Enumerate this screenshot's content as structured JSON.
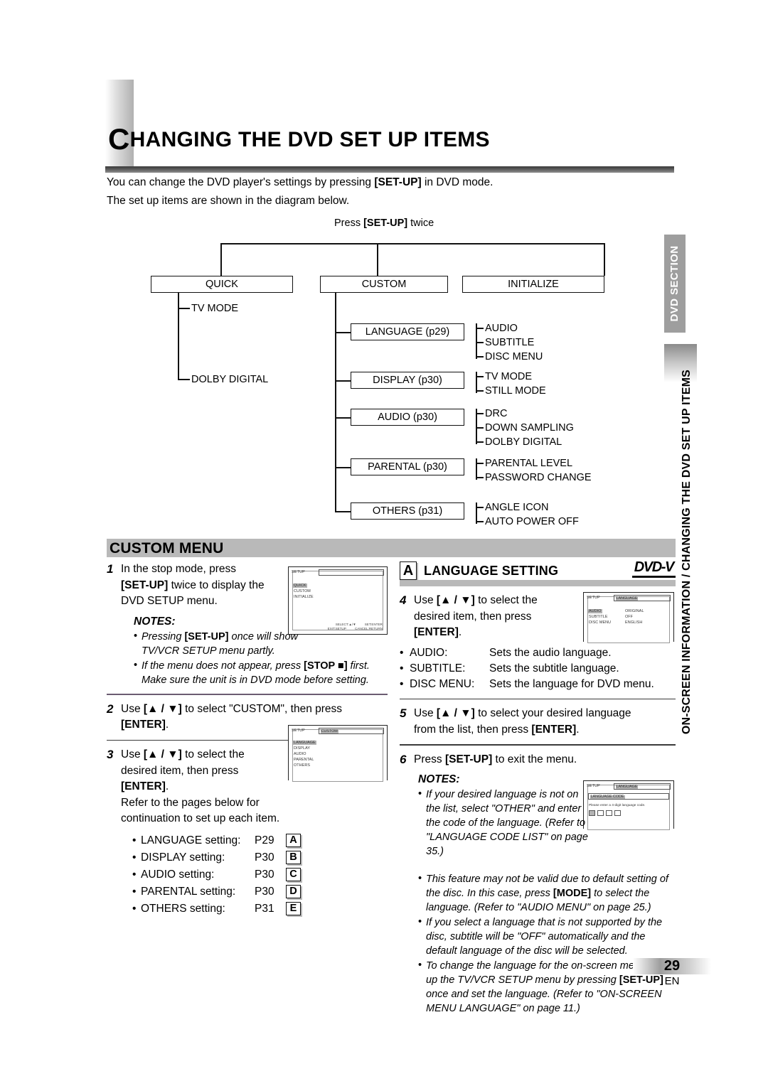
{
  "page": {
    "title_dropcap": "C",
    "title_rest": "HANGING THE DVD SET UP ITEMS",
    "intro_line_1_a": "You can change the DVD player's settings by pressing ",
    "intro_line_1_key": "[SET-UP]",
    "intro_line_1_b": " in DVD mode.",
    "intro_line_2": "The set up items are shown in the diagram below.",
    "page_number": "29",
    "page_lang": "EN"
  },
  "sidebar": {
    "tab_label": "DVD SECTION",
    "running_title": "ON-SCREEN INFORMATION / CHANGING THE DVD SET UP ITEMS"
  },
  "diagram": {
    "caption_a": "Press ",
    "caption_key": "[SET-UP]",
    "caption_b": " twice",
    "top_boxes": [
      "QUICK",
      "CUSTOM",
      "INITIALIZE"
    ],
    "quick_children": [
      "TV MODE",
      "DOLBY DIGITAL"
    ],
    "custom_children": [
      {
        "box": "LANGUAGE (p29)",
        "leaves": [
          "AUDIO",
          "SUBTITLE",
          "DISC MENU"
        ]
      },
      {
        "box": "DISPLAY (p30)",
        "leaves": [
          "TV MODE",
          "STILL MODE"
        ]
      },
      {
        "box": "AUDIO (p30)",
        "leaves": [
          "DRC",
          "DOWN SAMPLING",
          "DOLBY DIGITAL"
        ]
      },
      {
        "box": "PARENTAL (p30)",
        "leaves": [
          "PARENTAL LEVEL",
          "PASSWORD CHANGE"
        ]
      },
      {
        "box": "OTHERS (p31)",
        "leaves": [
          "ANGLE ICON",
          "AUTO POWER OFF"
        ]
      }
    ]
  },
  "custom_menu": {
    "heading": "CUSTOM MENU",
    "step1": {
      "num": "1",
      "t1": "In the stop mode, press",
      "k1": "[SET-UP]",
      "t2": " twice to display the",
      "t3": "DVD SETUP menu."
    },
    "step1_notes_title": "NOTES:",
    "step1_notes": [
      {
        "a": "Pressing ",
        "k": "[SET-UP]",
        "b": " once will show TV/VCR SETUP menu partly."
      },
      {
        "a": "If the menu does not appear, press ",
        "k": "[STOP ■]",
        "b": " first. Make sure the unit is in DVD mode before setting."
      }
    ],
    "step2": {
      "num": "2",
      "t1": "Use ",
      "k1": "[▲ / ▼]",
      "t2": " to select \"CUSTOM\", then press",
      "k2": "[ENTER]",
      "t3": "."
    },
    "step3": {
      "num": "3",
      "t1": "Use ",
      "k1": "[▲ / ▼]",
      "t2": " to select the",
      "t3": "desired item, then press",
      "k2": "[ENTER]",
      "t4": ".",
      "t5": "Refer to the pages below for",
      "t6": "continuation to set up each item."
    },
    "ref_rows": [
      {
        "name": "LANGUAGE setting:",
        "page": "P29",
        "badge": "A"
      },
      {
        "name": "DISPLAY setting:",
        "page": "P30",
        "badge": "B"
      },
      {
        "name": "AUDIO setting:",
        "page": "P30",
        "badge": "C"
      },
      {
        "name": "PARENTAL setting:",
        "page": "P30",
        "badge": "D"
      },
      {
        "name": "OTHERS setting:",
        "page": "P31",
        "badge": "E"
      }
    ]
  },
  "language_setting": {
    "badge": "A",
    "heading": "LANGUAGE SETTING",
    "logo": "DVD-V",
    "step4": {
      "num": "4",
      "t1": "Use ",
      "k1": "[▲ / ▼]",
      "t2": " to select the",
      "t3": "desired item, then press",
      "k2": "[ENTER]",
      "t4": "."
    },
    "defs": [
      {
        "key": "AUDIO:",
        "val": "Sets the audio language."
      },
      {
        "key": "SUBTITLE:",
        "val": "Sets the subtitle language."
      },
      {
        "key": "DISC MENU:",
        "val": "Sets the language for DVD menu."
      }
    ],
    "step5": {
      "num": "5",
      "t1": "Use ",
      "k1": "[▲ / ▼]",
      "t2": " to select your desired language",
      "t3": "from the list, then press ",
      "k2": "[ENTER]",
      "t4": "."
    },
    "step6": {
      "num": "6",
      "t1": "Press ",
      "k1": "[SET-UP]",
      "t2": " to exit the menu."
    },
    "notes_title": "NOTES:",
    "notes": [
      {
        "a": "If your desired language is not on the list, select \"OTHER\" and enter the code of the language. (Refer to \"LANGUAGE CODE LIST\" on page 35.)",
        "k": "",
        "b": ""
      },
      {
        "a": "This feature may not be valid due to default setting of the disc. In this case, press ",
        "k": "[MODE]",
        "b": " to select the language. (Refer to \"AUDIO MENU\" on page 25.)"
      },
      {
        "a": "If you select a language that is not supported by the disc, subtitle will be \"OFF\" automatically and the default language of the disc will be selected.",
        "k": "",
        "b": ""
      },
      {
        "a": "To change the language for the on-screen menus, call up the TV/VCR SETUP menu by pressing ",
        "k": "[SET-UP]",
        "b": " once and set the language. (Refer to \"ON-SCREEN MENU LANGUAGE\" on page 11.)"
      }
    ]
  },
  "osd_setup": {
    "setup_label": "SETUP",
    "mode": "",
    "items": [
      "QUICK",
      "CUSTOM",
      "INITIALIZE"
    ],
    "selected": "QUICK",
    "footer_1a": "SELECT:▲/▼",
    "footer_1b": "SET:ENTER",
    "footer_2a": "EXIT:SETUP",
    "footer_2b": "CANCEL:RETURN"
  },
  "osd_custom": {
    "setup_label": "SETUP",
    "mode": "CUSTOM",
    "items": [
      "LANGUAGE",
      "DISPLAY",
      "AUDIO",
      "PARENTAL",
      "OTHERS"
    ],
    "selected": "LANGUAGE"
  },
  "osd_language": {
    "setup_label": "SETUP",
    "mode": "LANGUAGE",
    "rows": [
      {
        "key": "AUDIO",
        "val": "ORIGINAL",
        "sel": true
      },
      {
        "key": "SUBTITLE",
        "val": "OFF",
        "sel": false
      },
      {
        "key": "DISC MENU",
        "val": "ENGLISH",
        "sel": false
      }
    ]
  },
  "osd_code": {
    "setup_label": "SETUP",
    "mode": "LANGUAGE",
    "code_box_label": "LANGUAGE CODE",
    "prompt": "Please enter a 4-digit language code."
  }
}
